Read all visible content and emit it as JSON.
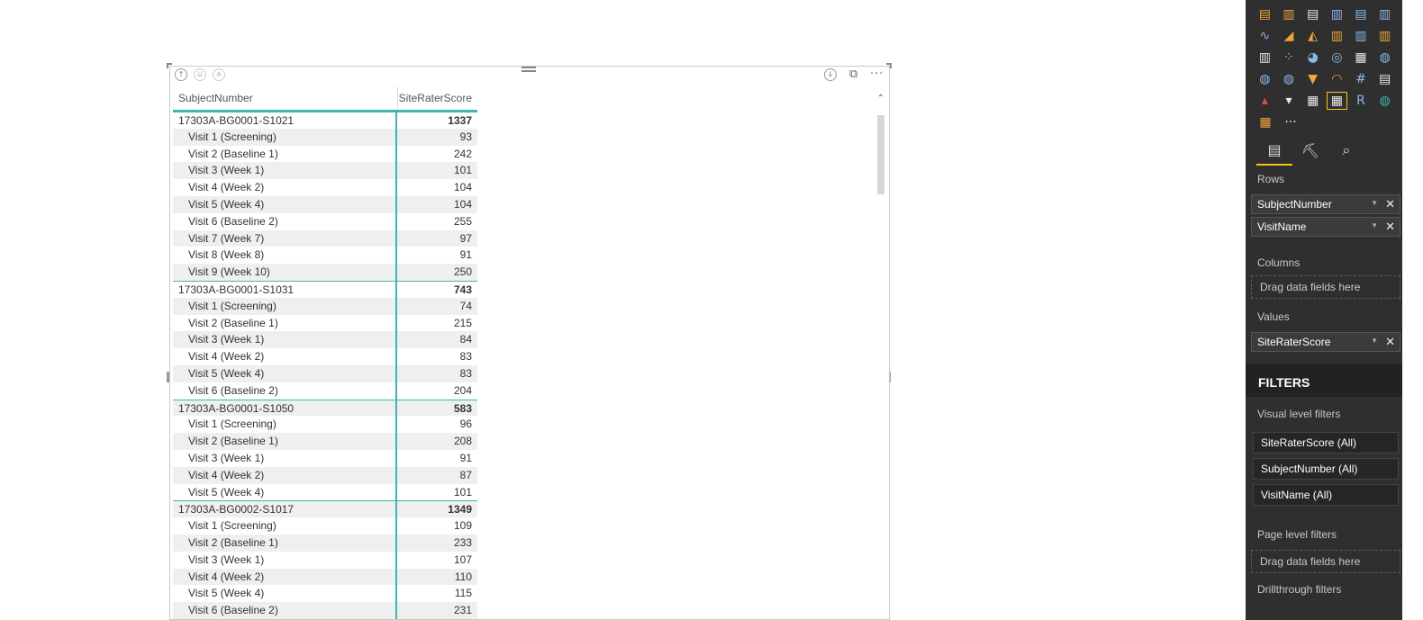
{
  "visual": {
    "header_icons": {
      "drill_up": "arrow-up-circle-icon",
      "drill_down_level": "double-arrow-icon",
      "expand_all": "fork-arrow-icon",
      "drill_mode": "arrow-down-circle-icon",
      "focus_mode": "focus-mode-icon",
      "more_options": "ellipsis-icon"
    },
    "matrix": {
      "columns": [
        "SubjectNumber",
        "SiteRaterScore"
      ],
      "rows": [
        {
          "type": "subject",
          "label": "17303A-BG0001-S1021",
          "value": "1337"
        },
        {
          "type": "visit",
          "label": "Visit 1 (Screening)",
          "value": "93"
        },
        {
          "type": "visit",
          "label": "Visit 2 (Baseline 1)",
          "value": "242"
        },
        {
          "type": "visit",
          "label": "Visit 3 (Week 1)",
          "value": "101"
        },
        {
          "type": "visit",
          "label": "Visit 4 (Week 2)",
          "value": "104"
        },
        {
          "type": "visit",
          "label": "Visit 5 (Week 4)",
          "value": "104"
        },
        {
          "type": "visit",
          "label": "Visit 6 (Baseline 2)",
          "value": "255"
        },
        {
          "type": "visit",
          "label": "Visit 7 (Week 7)",
          "value": "97"
        },
        {
          "type": "visit",
          "label": "Visit 8 (Week 8)",
          "value": "91"
        },
        {
          "type": "visit",
          "label": "Visit 9 (Week 10)",
          "value": "250"
        },
        {
          "type": "subject",
          "label": "17303A-BG0001-S1031",
          "value": "743"
        },
        {
          "type": "visit",
          "label": "Visit 1 (Screening)",
          "value": "74"
        },
        {
          "type": "visit",
          "label": "Visit 2 (Baseline 1)",
          "value": "215"
        },
        {
          "type": "visit",
          "label": "Visit 3 (Week 1)",
          "value": "84"
        },
        {
          "type": "visit",
          "label": "Visit 4 (Week 2)",
          "value": "83"
        },
        {
          "type": "visit",
          "label": "Visit 5 (Week 4)",
          "value": "83"
        },
        {
          "type": "visit",
          "label": "Visit 6 (Baseline 2)",
          "value": "204"
        },
        {
          "type": "subject",
          "label": "17303A-BG0001-S1050",
          "value": "583"
        },
        {
          "type": "visit",
          "label": "Visit 1 (Screening)",
          "value": "96"
        },
        {
          "type": "visit",
          "label": "Visit 2 (Baseline 1)",
          "value": "208"
        },
        {
          "type": "visit",
          "label": "Visit 3 (Week 1)",
          "value": "91"
        },
        {
          "type": "visit",
          "label": "Visit 4 (Week 2)",
          "value": "87"
        },
        {
          "type": "visit",
          "label": "Visit 5 (Week 4)",
          "value": "101"
        },
        {
          "type": "subject",
          "label": "17303A-BG0002-S1017",
          "value": "1349"
        },
        {
          "type": "visit",
          "label": "Visit 1 (Screening)",
          "value": "109"
        },
        {
          "type": "visit",
          "label": "Visit 2 (Baseline 1)",
          "value": "233"
        },
        {
          "type": "visit",
          "label": "Visit 3 (Week 1)",
          "value": "107"
        },
        {
          "type": "visit",
          "label": "Visit 4 (Week 2)",
          "value": "110"
        },
        {
          "type": "visit",
          "label": "Visit 5 (Week 4)",
          "value": "115"
        },
        {
          "type": "visit",
          "label": "Visit 6 (Baseline 2)",
          "value": "231"
        }
      ]
    }
  },
  "panel": {
    "visualizations": [
      [
        {
          "icon": "stacked-bar-icon",
          "glyph": "▤",
          "color": "#f2a33a"
        },
        {
          "icon": "stacked-column-icon",
          "glyph": "▥",
          "color": "#f2a33a"
        },
        {
          "icon": "clustered-bar-icon",
          "glyph": "▤",
          "color": "#e8e8e8"
        },
        {
          "icon": "clustered-column-icon",
          "glyph": "▥",
          "color": "#8bb8e8"
        },
        {
          "icon": "100-stacked-bar-icon",
          "glyph": "▤",
          "color": "#8bb8e8"
        },
        {
          "icon": "100-stacked-column-icon",
          "glyph": "▥",
          "color": "#8bb8e8"
        }
      ],
      [
        {
          "icon": "line-chart-icon",
          "glyph": "∿",
          "color": "#8bb8e8"
        },
        {
          "icon": "area-chart-icon",
          "glyph": "◢",
          "color": "#f2a33a"
        },
        {
          "icon": "stacked-area-icon",
          "glyph": "◭",
          "color": "#f2a33a"
        },
        {
          "icon": "line-clustered-column-icon",
          "glyph": "▥",
          "color": "#f2a33a"
        },
        {
          "icon": "line-stacked-column-icon",
          "glyph": "▥",
          "color": "#8bb8e8"
        },
        {
          "icon": "ribbon-chart-icon",
          "glyph": "▥",
          "color": "#f2a33a"
        }
      ],
      [
        {
          "icon": "waterfall-icon",
          "glyph": "▥",
          "color": "#e8e8e8"
        },
        {
          "icon": "scatter-icon",
          "glyph": "⁘",
          "color": "#8bb8e8"
        },
        {
          "icon": "pie-chart-icon",
          "glyph": "◕",
          "color": "#8bb8e8"
        },
        {
          "icon": "donut-chart-icon",
          "glyph": "◎",
          "color": "#8bb8e8"
        },
        {
          "icon": "treemap-icon",
          "glyph": "▦",
          "color": "#e8e8e8"
        },
        {
          "icon": "map-icon",
          "glyph": "◍",
          "color": "#8bb8e8"
        }
      ],
      [
        {
          "icon": "filled-map-icon",
          "glyph": "◍",
          "color": "#8bb8e8"
        },
        {
          "icon": "shape-map-icon",
          "glyph": "◍",
          "color": "#8bb8e8"
        },
        {
          "icon": "funnel-icon",
          "glyph": "▼",
          "color": "#f2a33a"
        },
        {
          "icon": "gauge-icon",
          "glyph": "◠",
          "color": "#f2a33a"
        },
        {
          "icon": "card-icon",
          "glyph": "#",
          "color": "#8bb8e8"
        },
        {
          "icon": "multi-row-card-icon",
          "glyph": "▤",
          "color": "#e8e8e8"
        }
      ],
      [
        {
          "icon": "kpi-icon",
          "glyph": "▴",
          "color": "#e04a3f"
        },
        {
          "icon": "slicer-icon",
          "glyph": "▾",
          "color": "#e8e8e8"
        },
        {
          "icon": "table-icon",
          "glyph": "▦",
          "color": "#e8e8e8"
        },
        {
          "icon": "matrix-icon",
          "glyph": "▦",
          "color": "#e8e8e8",
          "selected": true
        },
        {
          "icon": "r-visual-icon",
          "glyph": "R",
          "color": "#8bb8e8"
        },
        {
          "icon": "arcgis-map-icon",
          "glyph": "◍",
          "color": "#3fb6a8"
        }
      ],
      [
        {
          "icon": "custom-visual-icon",
          "glyph": "▦",
          "color": "#f2a33a"
        },
        {
          "icon": "more-visuals-icon",
          "glyph": "···",
          "color": "#e8e8e8"
        }
      ]
    ],
    "tabs": [
      {
        "icon": "fields-icon",
        "glyph": "▤",
        "active": true
      },
      {
        "icon": "format-paint-roller-icon",
        "glyph": "⛏",
        "active": false
      },
      {
        "icon": "analytics-magnifier-icon",
        "glyph": "⌕",
        "active": false
      }
    ],
    "rows_label": "Rows",
    "rows_fields": [
      "SubjectNumber",
      "VisitName"
    ],
    "columns_label": "Columns",
    "columns_placeholder": "Drag data fields here",
    "values_label": "Values",
    "values_fields": [
      "SiteRaterScore"
    ],
    "filters_title": "FILTERS",
    "visual_filters_label": "Visual level filters",
    "visual_filters": [
      "SiteRaterScore (All)",
      "SubjectNumber (All)",
      "VisitName (All)"
    ],
    "page_filters_label": "Page level filters",
    "page_filters_placeholder": "Drag data fields here",
    "drillthrough_label": "Drillthrough filters"
  }
}
